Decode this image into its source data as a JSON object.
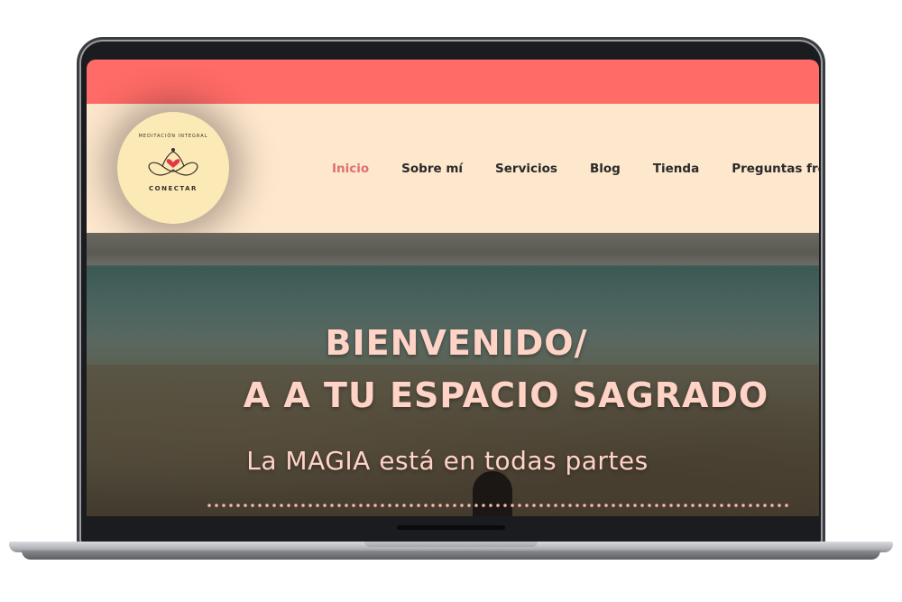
{
  "header": {
    "logo": {
      "arc_text": "MEDITACIÓN INTEGRAL",
      "name": "CONECTAR"
    },
    "nav": {
      "items": [
        {
          "label": "Inicio",
          "active": true
        },
        {
          "label": "Sobre mí",
          "active": false
        },
        {
          "label": "Servicios",
          "active": false
        },
        {
          "label": "Blog",
          "active": false
        },
        {
          "label": "Tienda",
          "active": false
        },
        {
          "label": "Preguntas frecue",
          "active": false
        }
      ]
    }
  },
  "hero": {
    "title_line_1": "BIENVENIDO/",
    "title_line_2": "A A TU ESPACIO SAGRADO",
    "subtitle": "La MAGIA está en todas partes"
  },
  "colors": {
    "top_strip": "#ff6b66",
    "header_bg": "#fde7cd",
    "nav_active": "#e07070",
    "nav_text": "#2a2a2a",
    "hero_text": "#ffd3c6",
    "logo_bg": "#fbeab5"
  }
}
